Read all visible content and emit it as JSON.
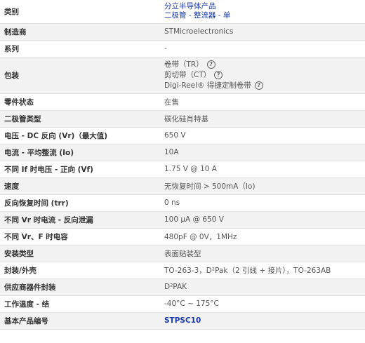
{
  "rows": [
    {
      "label": "类别",
      "lines": [
        "分立半导体产品",
        "二极管 - 整流器 - 单"
      ],
      "style": "link"
    },
    {
      "label": "制造商",
      "value": "STMicroelectronics"
    },
    {
      "label": "系列",
      "value": "-"
    },
    {
      "label": "包装",
      "packaging": [
        {
          "text": "卷带（TR）",
          "icon": "help-circle-icon"
        },
        {
          "text": "剪切带（CT）",
          "icon": "help-circle-icon"
        },
        {
          "text": "Digi-Reel® 得捷定制卷带",
          "icon": "help-circle-icon"
        }
      ]
    },
    {
      "label": "零件状态",
      "value": "在售"
    },
    {
      "label": "二极管类型",
      "value": "碳化硅肖特基"
    },
    {
      "label": "电压 - DC 反向 (Vr)（最大值)",
      "value": "650 V"
    },
    {
      "label": "电流 - 平均整流 (Io)",
      "value": "10A"
    },
    {
      "label": "不同 If 时电压 - 正向 (Vf)",
      "value": "1.75 V @ 10 A"
    },
    {
      "label": "速度",
      "value": "无恢复时间 > 500mA（Io)"
    },
    {
      "label": "反向恢复时间 (trr)",
      "value": "0 ns"
    },
    {
      "label": "不同 Vr 时电流 - 反向泄漏",
      "value": "100 µA @ 650 V"
    },
    {
      "label": "不同 Vr、F 时电容",
      "value": "480pF @ 0V，1MHz"
    },
    {
      "label": "安装类型",
      "value": "表面贴装型"
    },
    {
      "label": "封装/外壳",
      "value": "TO-263-3，D²Pak（2 引线 + 接片），TO-263AB"
    },
    {
      "label": "供应商器件封装",
      "value": "D²PAK"
    },
    {
      "label": "工作温度 - 结",
      "value": "-40°C ~ 175°C"
    },
    {
      "label": "基本产品编号",
      "value": "STPSC10",
      "style": "link-bold"
    }
  ],
  "colors": {
    "link": "#1a3aa8",
    "alt_row_bg": "#f2f2f2",
    "border": "#e2e2e2"
  }
}
